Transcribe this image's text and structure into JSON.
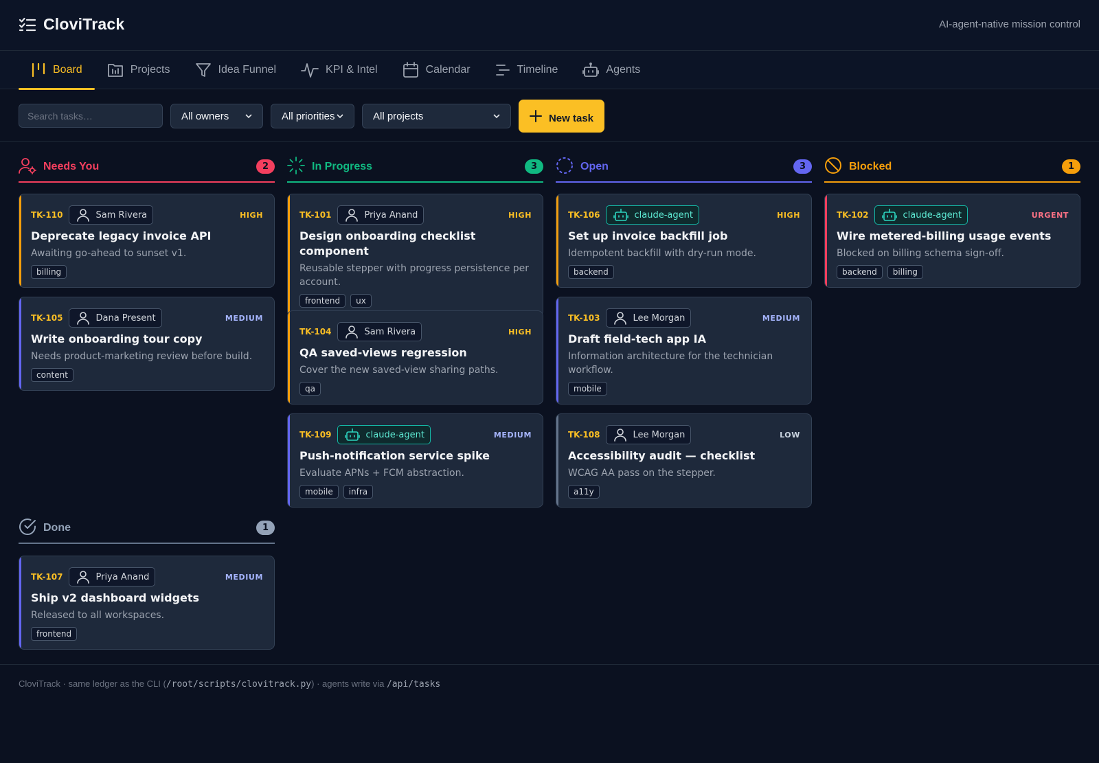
{
  "app": {
    "name": "CloviTrack",
    "tagline": "AI-agent-native mission control"
  },
  "nav": [
    {
      "label": "Board",
      "icon": "board-icon",
      "active": true
    },
    {
      "label": "Projects",
      "icon": "projects-icon"
    },
    {
      "label": "Idea Funnel",
      "icon": "funnel-icon"
    },
    {
      "label": "KPI & Intel",
      "icon": "activity-icon"
    },
    {
      "label": "Calendar",
      "icon": "calendar-icon"
    },
    {
      "label": "Timeline",
      "icon": "timeline-icon"
    },
    {
      "label": "Agents",
      "icon": "robot-icon"
    }
  ],
  "toolbar": {
    "search_placeholder": "Search tasks…",
    "owner_filter": "All owners",
    "priority_filter": "All priorities",
    "project_filter": "All projects",
    "new_task_label": "New task"
  },
  "colors": {
    "needs_you": "#f43f5e",
    "in_progress": "#10b981",
    "open": "#6366f1",
    "blocked": "#f59e0b",
    "done": "#94a3b8",
    "accent": "#fbbf24",
    "high": "#fbbf24",
    "medium": "#a5b4fc",
    "low": "#cbd5e1",
    "urgent": "#fb7185"
  },
  "columns": {
    "needs_you": {
      "title": "Needs You",
      "count": "2",
      "icon": "user-gear-icon",
      "cards": [
        {
          "id": "TK-110",
          "owner": "Sam Rivera",
          "agent": false,
          "priority": "HIGH",
          "title": "Deprecate legacy invoice API",
          "desc": "Awaiting go-ahead to sunset v1.",
          "tags": [
            "billing"
          ]
        },
        {
          "id": "TK-105",
          "owner": "Dana Present",
          "agent": false,
          "priority": "MEDIUM",
          "title": "Write onboarding tour copy",
          "desc": "Needs product-marketing review before build.",
          "tags": [
            "content"
          ]
        }
      ]
    },
    "in_progress": {
      "title": "In Progress",
      "count": "3",
      "icon": "loader-icon",
      "cards": [
        {
          "id": "TK-101",
          "owner": "Priya Anand",
          "agent": false,
          "priority": "HIGH",
          "title": "Design onboarding checklist component",
          "desc": "Reusable stepper with progress persistence per account.",
          "tags": [
            "frontend",
            "ux"
          ]
        },
        {
          "id": "TK-104",
          "owner": "Sam Rivera",
          "agent": false,
          "priority": "HIGH",
          "title": "QA saved-views regression",
          "desc": "Cover the new saved-view sharing paths.",
          "tags": [
            "qa"
          ]
        },
        {
          "id": "TK-109",
          "owner": "claude-agent",
          "agent": true,
          "priority": "MEDIUM",
          "title": "Push-notification service spike",
          "desc": "Evaluate APNs + FCM abstraction.",
          "tags": [
            "mobile",
            "infra"
          ]
        }
      ]
    },
    "open": {
      "title": "Open",
      "count": "3",
      "icon": "dashed-circle-icon",
      "cards": [
        {
          "id": "TK-106",
          "owner": "claude-agent",
          "agent": true,
          "priority": "HIGH",
          "title": "Set up invoice backfill job",
          "desc": "Idempotent backfill with dry-run mode.",
          "tags": [
            "backend"
          ]
        },
        {
          "id": "TK-103",
          "owner": "Lee Morgan",
          "agent": false,
          "priority": "MEDIUM",
          "title": "Draft field-tech app IA",
          "desc": "Information architecture for the technician workflow.",
          "tags": [
            "mobile"
          ]
        },
        {
          "id": "TK-108",
          "owner": "Lee Morgan",
          "agent": false,
          "priority": "LOW",
          "title": "Accessibility audit — checklist",
          "desc": "WCAG AA pass on the stepper.",
          "tags": [
            "a11y"
          ]
        }
      ]
    },
    "blocked": {
      "title": "Blocked",
      "count": "1",
      "icon": "ban-icon",
      "cards": [
        {
          "id": "TK-102",
          "owner": "claude-agent",
          "agent": true,
          "priority": "URGENT",
          "title": "Wire metered-billing usage events",
          "desc": "Blocked on billing schema sign-off.",
          "tags": [
            "backend",
            "billing"
          ]
        }
      ]
    },
    "done": {
      "title": "Done",
      "count": "1",
      "icon": "check-circle-icon",
      "cards": [
        {
          "id": "TK-107",
          "owner": "Priya Anand",
          "agent": false,
          "priority": "MEDIUM",
          "title": "Ship v2 dashboard widgets",
          "desc": "Released to all workspaces.",
          "tags": [
            "frontend"
          ]
        }
      ]
    }
  },
  "footer": {
    "prefix": "CloviTrack · same ledger as the CLI (",
    "cli_path": "/root/scripts/clovitrack.py",
    "middle": ") · agents write via ",
    "api_path": "/api/tasks"
  }
}
